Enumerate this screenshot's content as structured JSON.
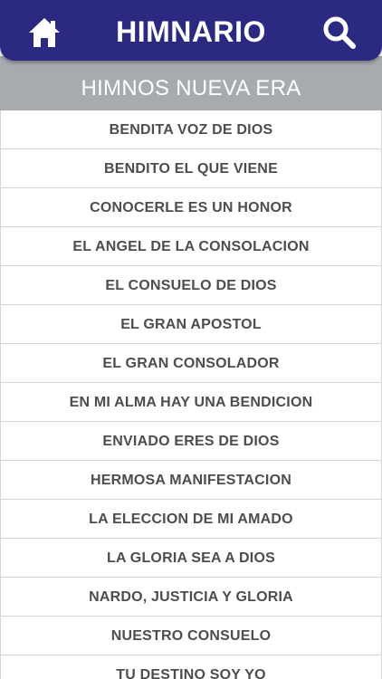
{
  "header": {
    "title": "HIMNARIO",
    "home_icon": "home-icon",
    "search_icon": "search-icon",
    "color": "#2b2a80"
  },
  "section": {
    "title": "HIMNOS NUEVA ERA",
    "color": "#a7abb0"
  },
  "hymns": [
    "BENDITA VOZ DE DIOS",
    "BENDITO EL QUE VIENE",
    "CONOCERLE ES UN HONOR",
    "EL ANGEL DE LA CONSOLACION",
    "EL CONSUELO DE DIOS",
    "EL GRAN APOSTOL",
    "EL GRAN CONSOLADOR",
    "EN MI ALMA HAY UNA BENDICION",
    "ENVIADO ERES DE DIOS",
    "HERMOSA MANIFESTACION",
    "LA ELECCION DE MI AMADO",
    "LA GLORIA SEA A DIOS",
    "NARDO, JUSTICIA Y GLORIA",
    "NUESTRO CONSUELO",
    "TU DESTINO SOY YO"
  ]
}
